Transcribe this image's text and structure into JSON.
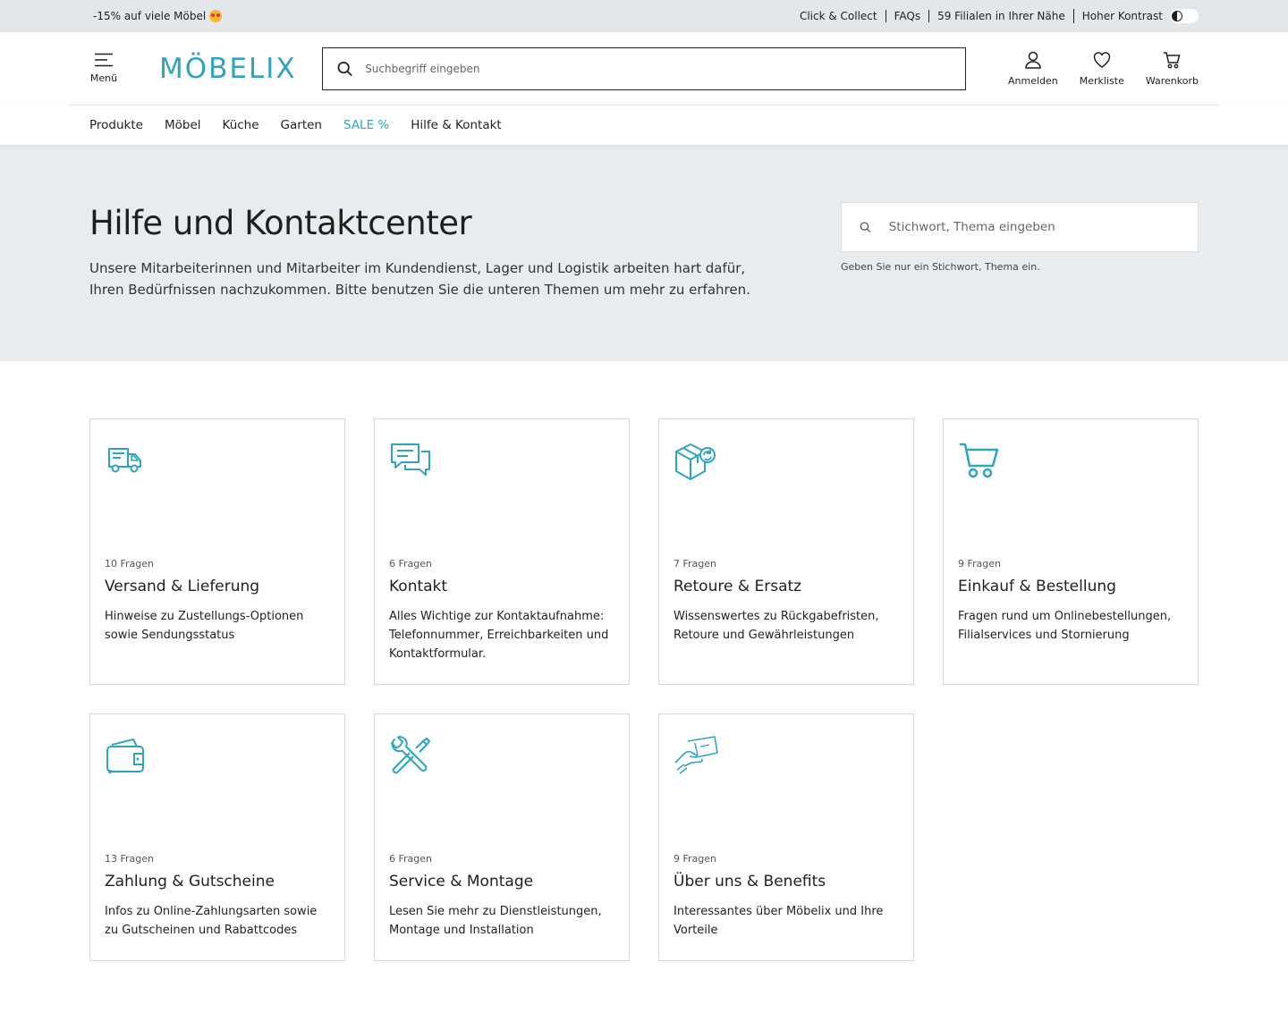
{
  "topbar": {
    "promo": "-15% auf viele Möbel",
    "links": [
      "Click & Collect",
      "FAQs",
      "59 Filialen in Ihrer Nähe"
    ],
    "contrast_label": "Hoher Kontrast"
  },
  "header": {
    "menu_label": "Menü",
    "logo": "MÖBELIX",
    "search_placeholder": "Suchbegriff eingeben",
    "login_label": "Anmelden",
    "wishlist_label": "Merkliste",
    "cart_label": "Warenkorb"
  },
  "nav": {
    "items": [
      "Produkte",
      "Möbel",
      "Küche",
      "Garten",
      "SALE %",
      "Hilfe & Kontakt"
    ]
  },
  "hero": {
    "title": "Hilfe und Kontaktcenter",
    "text": "Unsere Mitarbeiterinnen und Mitarbeiter im Kundendienst, Lager und Logistik arbeiten hart dafür, Ihren Bedürfnissen nachzukommen. Bitte benutzen Sie die unteren Themen um mehr zu erfahren.",
    "search_placeholder": "Stichwort, Thema eingeben",
    "search_hint": "Geben Sie nur ein Stichwort, Thema ein."
  },
  "cards": [
    {
      "icon": "truck-icon",
      "count": "10 Fragen",
      "title": "Versand & Lieferung",
      "desc": "Hinweise zu Zustellungs-Optionen sowie Sendungsstatus"
    },
    {
      "icon": "chat-icon",
      "count": "6 Fragen",
      "title": "Kontakt",
      "desc": "Alles Wichtige zur Kontaktaufnahme: Telefonnummer, Erreichbarkeiten und Kontaktformular."
    },
    {
      "icon": "package-return-icon",
      "count": "7 Fragen",
      "title": "Retoure & Ersatz",
      "desc": "Wissenswertes zu Rückgabefristen, Retoure und Gewährleistungen"
    },
    {
      "icon": "cart-icon",
      "count": "9 Fragen",
      "title": "Einkauf & Bestellung",
      "desc": "Fragen rund um Onlinebestellungen, Filialservices und Stornierung"
    },
    {
      "icon": "wallet-icon",
      "count": "13 Fragen",
      "title": "Zahlung & Gutscheine",
      "desc": "Infos zu Online-Zahlungsarten sowie zu Gutscheinen und Rabattcodes"
    },
    {
      "icon": "tools-icon",
      "count": "6 Fragen",
      "title": "Service & Montage",
      "desc": "Lesen Sie mehr zu Dienstleistungen, Montage und Installation"
    },
    {
      "icon": "hand-card-icon",
      "count": "9 Fragen",
      "title": "Über uns & Benefits",
      "desc": "Interessantes über Möbelix und Ihre Vorteile"
    }
  ],
  "colors": {
    "accent": "#2ea4bd",
    "hero_bg": "#e9ecef",
    "topbar_bg": "#e3e7ea"
  }
}
